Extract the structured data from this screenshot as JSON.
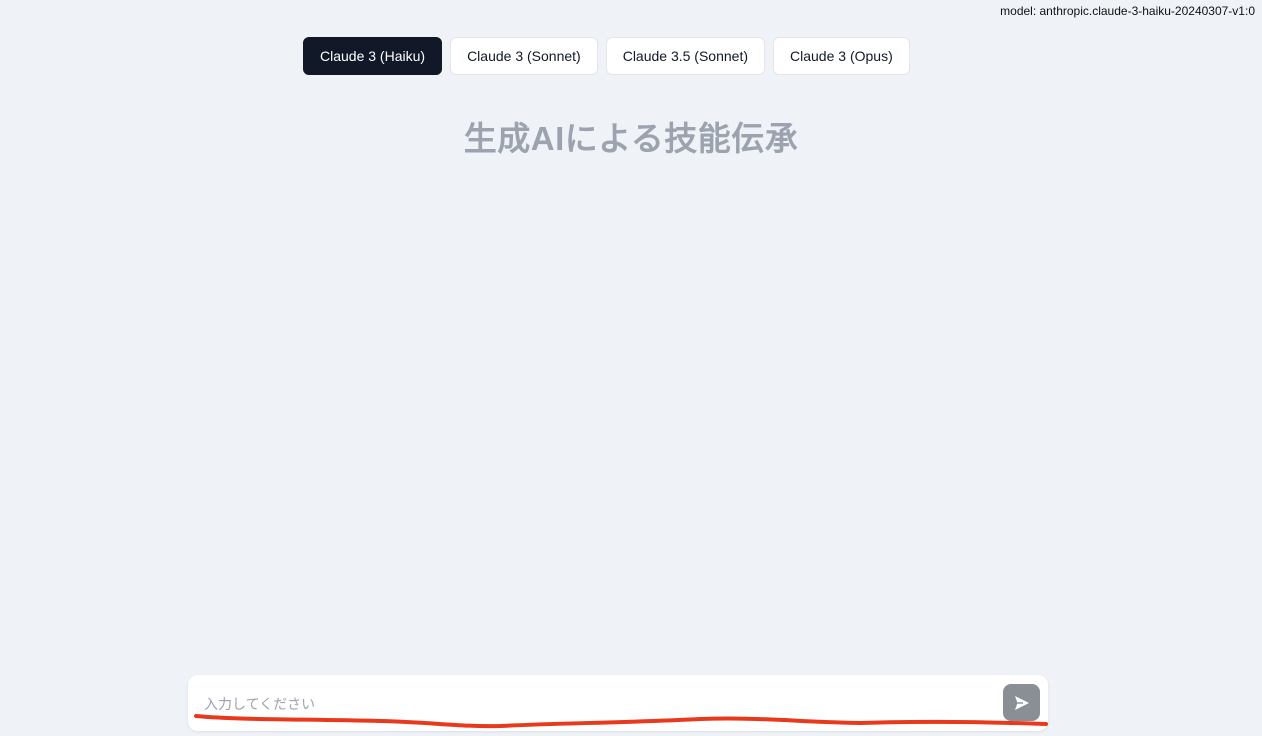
{
  "model_label": "model: anthropic.claude-3-haiku-20240307-v1:0",
  "model_tabs": [
    {
      "label": "Claude 3 (Haiku)",
      "active": true
    },
    {
      "label": "Claude 3 (Sonnet)",
      "active": false
    },
    {
      "label": "Claude 3.5 (Sonnet)",
      "active": false
    },
    {
      "label": "Claude 3 (Opus)",
      "active": false
    }
  ],
  "title": "生成AIによる技能伝承",
  "chat_input": {
    "placeholder": "入力してください",
    "value": ""
  },
  "send_button": {
    "icon": "send-icon"
  },
  "colors": {
    "background": "#eff2f7",
    "active_tab": "#111827",
    "title": "#9ca3af",
    "send_button": "#8a8f96",
    "annotation": "#e8391c"
  }
}
